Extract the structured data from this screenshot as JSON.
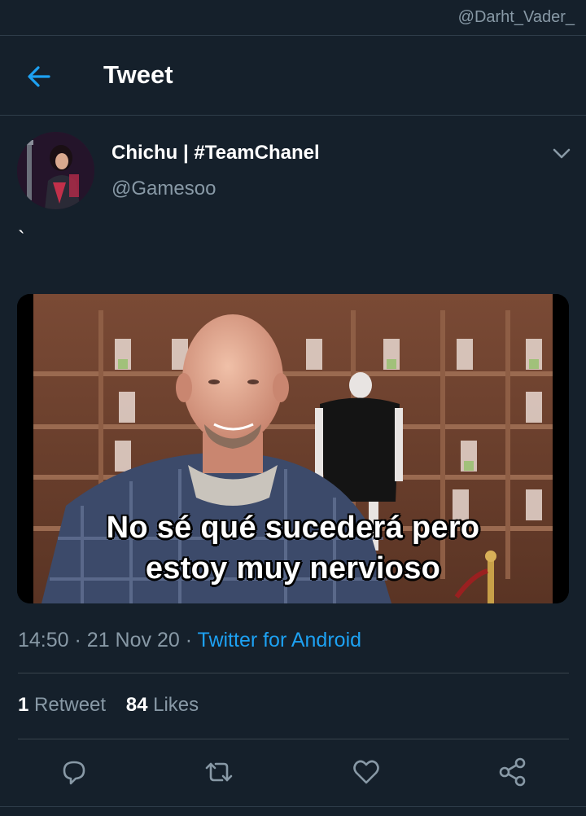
{
  "watermark": "@Darht_Vader_",
  "header": {
    "title": "Tweet",
    "back_icon": "arrow-left-icon"
  },
  "tweet": {
    "display_name": "Chichu | #TeamChanel",
    "handle": "@Gamesoo",
    "text": "`",
    "media": {
      "caption_line1": "No sé qué sucederá pero",
      "caption_line2": "estoy muy nervioso"
    },
    "time": "14:50",
    "date": "21 Nov 20",
    "source": "Twitter for Android"
  },
  "stats": {
    "retweets_count": "1",
    "retweets_label": "Retweet",
    "likes_count": "84",
    "likes_label": "Likes"
  },
  "actions": [
    "reply-icon",
    "retweet-icon",
    "like-icon",
    "share-icon"
  ],
  "colors": {
    "background": "#15202b",
    "accent": "#1da1f2",
    "muted": "#8899a6"
  }
}
